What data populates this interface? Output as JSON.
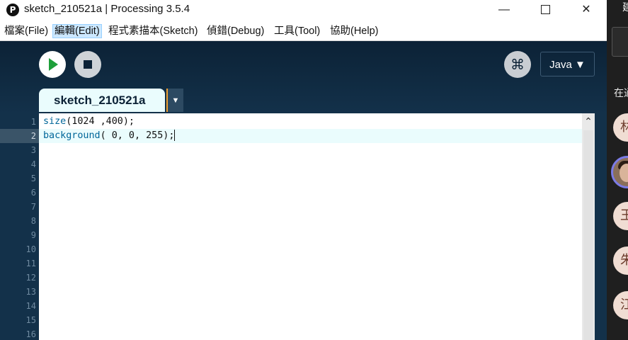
{
  "window": {
    "app_icon": "P",
    "title": "sketch_210521a | Processing 3.5.4",
    "controls": {
      "minimize": "—",
      "close": "✕"
    }
  },
  "menubar": {
    "items": [
      {
        "label": "檔案(File)"
      },
      {
        "label": "編輯(Edit)"
      },
      {
        "label": "程式素描本(Sketch)"
      },
      {
        "label": "偵錯(Debug)"
      },
      {
        "label": "工具(Tool)"
      },
      {
        "label": "協助(Help)"
      }
    ]
  },
  "toolbar": {
    "run_icon": "play-icon",
    "stop_icon": "stop-icon",
    "debug_icon": "debugger-icon",
    "debug_glyph": "⌘",
    "mode_label": "Java ▼"
  },
  "tabs": {
    "active_label": "sketch_210521a",
    "menu_arrow": "▼"
  },
  "editor": {
    "line_numbers": [
      "1",
      "2",
      "3",
      "4",
      "5",
      "6",
      "7",
      "8",
      "9",
      "10",
      "11",
      "12",
      "13",
      "14",
      "15",
      "16"
    ],
    "current_line": 2,
    "lines": [
      {
        "fn": "size",
        "rest": "(1024 ,400);"
      },
      {
        "fn": "background",
        "rest": "( 0, 0, 255);"
      }
    ],
    "scroll_up_glyph": "⌃"
  },
  "side_panel": {
    "top_text": "建",
    "label": "在通",
    "avatars": [
      {
        "initial": "林"
      },
      {
        "initial": ""
      },
      {
        "initial": "王"
      },
      {
        "initial": "朱"
      },
      {
        "initial": "江"
      }
    ]
  },
  "colors": {
    "toolbar_bg": "#0c2236",
    "gutter_bg": "#13314a",
    "tab_bg": "#eafcfd",
    "function_color": "#006699",
    "run_green": "#1e9f3a",
    "mode_dropdown_arrow": "#f0a030"
  }
}
